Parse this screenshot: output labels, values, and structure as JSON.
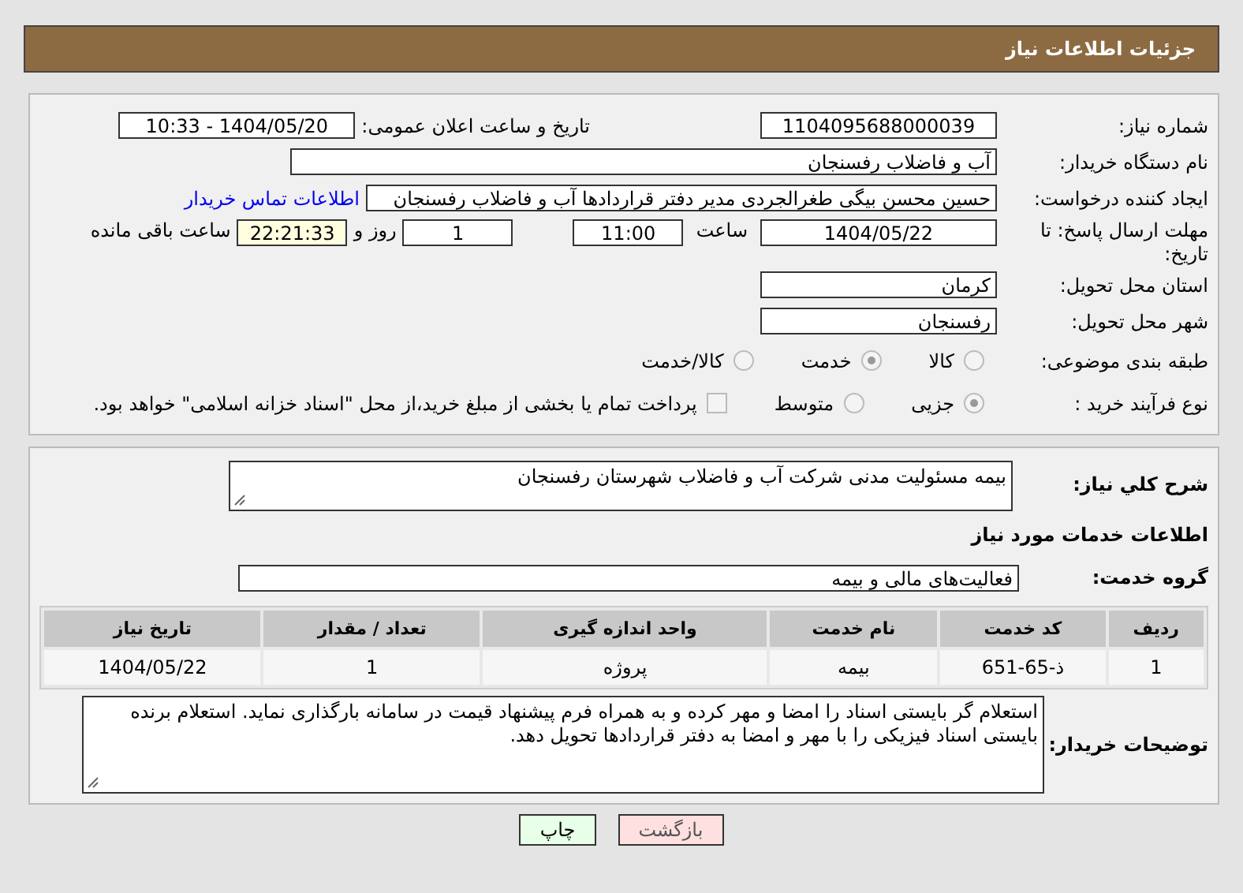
{
  "header": {
    "title": "جزئیات اطلاعات نیاز"
  },
  "need_number": {
    "label": "شماره نیاز:",
    "value": "1104095688000039"
  },
  "announce": {
    "label": "تاریخ و ساعت اعلان عمومی:",
    "value": "1404/05/20 - 10:33"
  },
  "buyer_org": {
    "label": "نام دستگاه خریدار:",
    "value": "آب و فاضلاب رفسنجان"
  },
  "creator": {
    "label": "ایجاد کننده درخواست:",
    "value": "حسین محسن بیگی طغرالجردی مدیر دفتر قراردادها آب و فاضلاب رفسنجان",
    "link": "اطلاعات تماس خریدار"
  },
  "deadline": {
    "label": "مهلت ارسال پاسخ: تا تاریخ:",
    "date": "1404/05/22",
    "time_label": "ساعت",
    "time": "11:00",
    "days": "1",
    "days_label": "روز و",
    "remaining": "22:21:33",
    "remaining_label": "ساعت باقی مانده"
  },
  "province": {
    "label": "استان محل تحویل:",
    "value": "کرمان"
  },
  "city": {
    "label": "شهر محل تحویل:",
    "value": "رفسنجان"
  },
  "category": {
    "label": "طبقه بندی موضوعی:",
    "options": [
      {
        "label": "کالا",
        "selected": false
      },
      {
        "label": "خدمت",
        "selected": true
      },
      {
        "label": "کالا/خدمت",
        "selected": false
      }
    ]
  },
  "process": {
    "label": "نوع فرآیند خرید :",
    "options": [
      {
        "label": "جزیی",
        "selected": true
      },
      {
        "label": "متوسط",
        "selected": false
      }
    ],
    "checkbox": {
      "checked": false,
      "label": "پرداخت تمام یا بخشی از مبلغ خرید،از محل \"اسناد خزانه اسلامی\" خواهد بود."
    }
  },
  "description": {
    "label": "شرح کلي نياز:",
    "value": "بیمه مسئولیت مدنی شرکت آب و فاضلاب شهرستان رفسنجان"
  },
  "services_title": "اطلاعات خدمات مورد نیاز",
  "service_group": {
    "label": "گروه خدمت:",
    "value": "فعالیت‌های مالی و بیمه"
  },
  "table": {
    "columns": [
      "ردیف",
      "کد خدمت",
      "نام خدمت",
      "واحد اندازه گیری",
      "تعداد / مقدار",
      "تاریخ نیاز"
    ],
    "rows": [
      [
        "1",
        "ذ-65-651",
        "بیمه",
        "پروژه",
        "1",
        "1404/05/22"
      ]
    ]
  },
  "notes": {
    "label": "توضیحات خریدار:",
    "value": "استعلام گر بایستی اسناد را امضا و مهر کرده و به همراه فرم پیشنهاد قیمت در سامانه بارگذاری نماید. استعلام برنده بایستی اسناد فیزیکی را با مهر و امضا به دفتر قراردادها تحویل دهد."
  },
  "buttons": [
    {
      "label": "بازگشت",
      "kind": "back"
    },
    {
      "label": "چاپ",
      "kind": "print"
    }
  ]
}
